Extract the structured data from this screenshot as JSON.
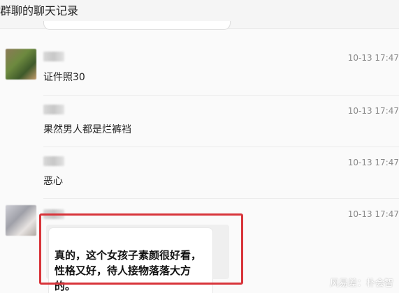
{
  "header": {
    "title": "群聊的聊天记录"
  },
  "messages": [
    {
      "time": "10-13 17:47",
      "text": "证件照30"
    },
    {
      "time": "10-13 17:47",
      "text": "果然男人都是烂裤裆"
    },
    {
      "time": "10-13 17:47",
      "text": "恶心"
    },
    {
      "time": "10-13 17:47",
      "text": "真的，这个女孩子素颜很好看，性格又好，待人接物落落大方的。"
    }
  ],
  "highlight_color": "#d8343a",
  "watermark": "风易差：朴会智"
}
